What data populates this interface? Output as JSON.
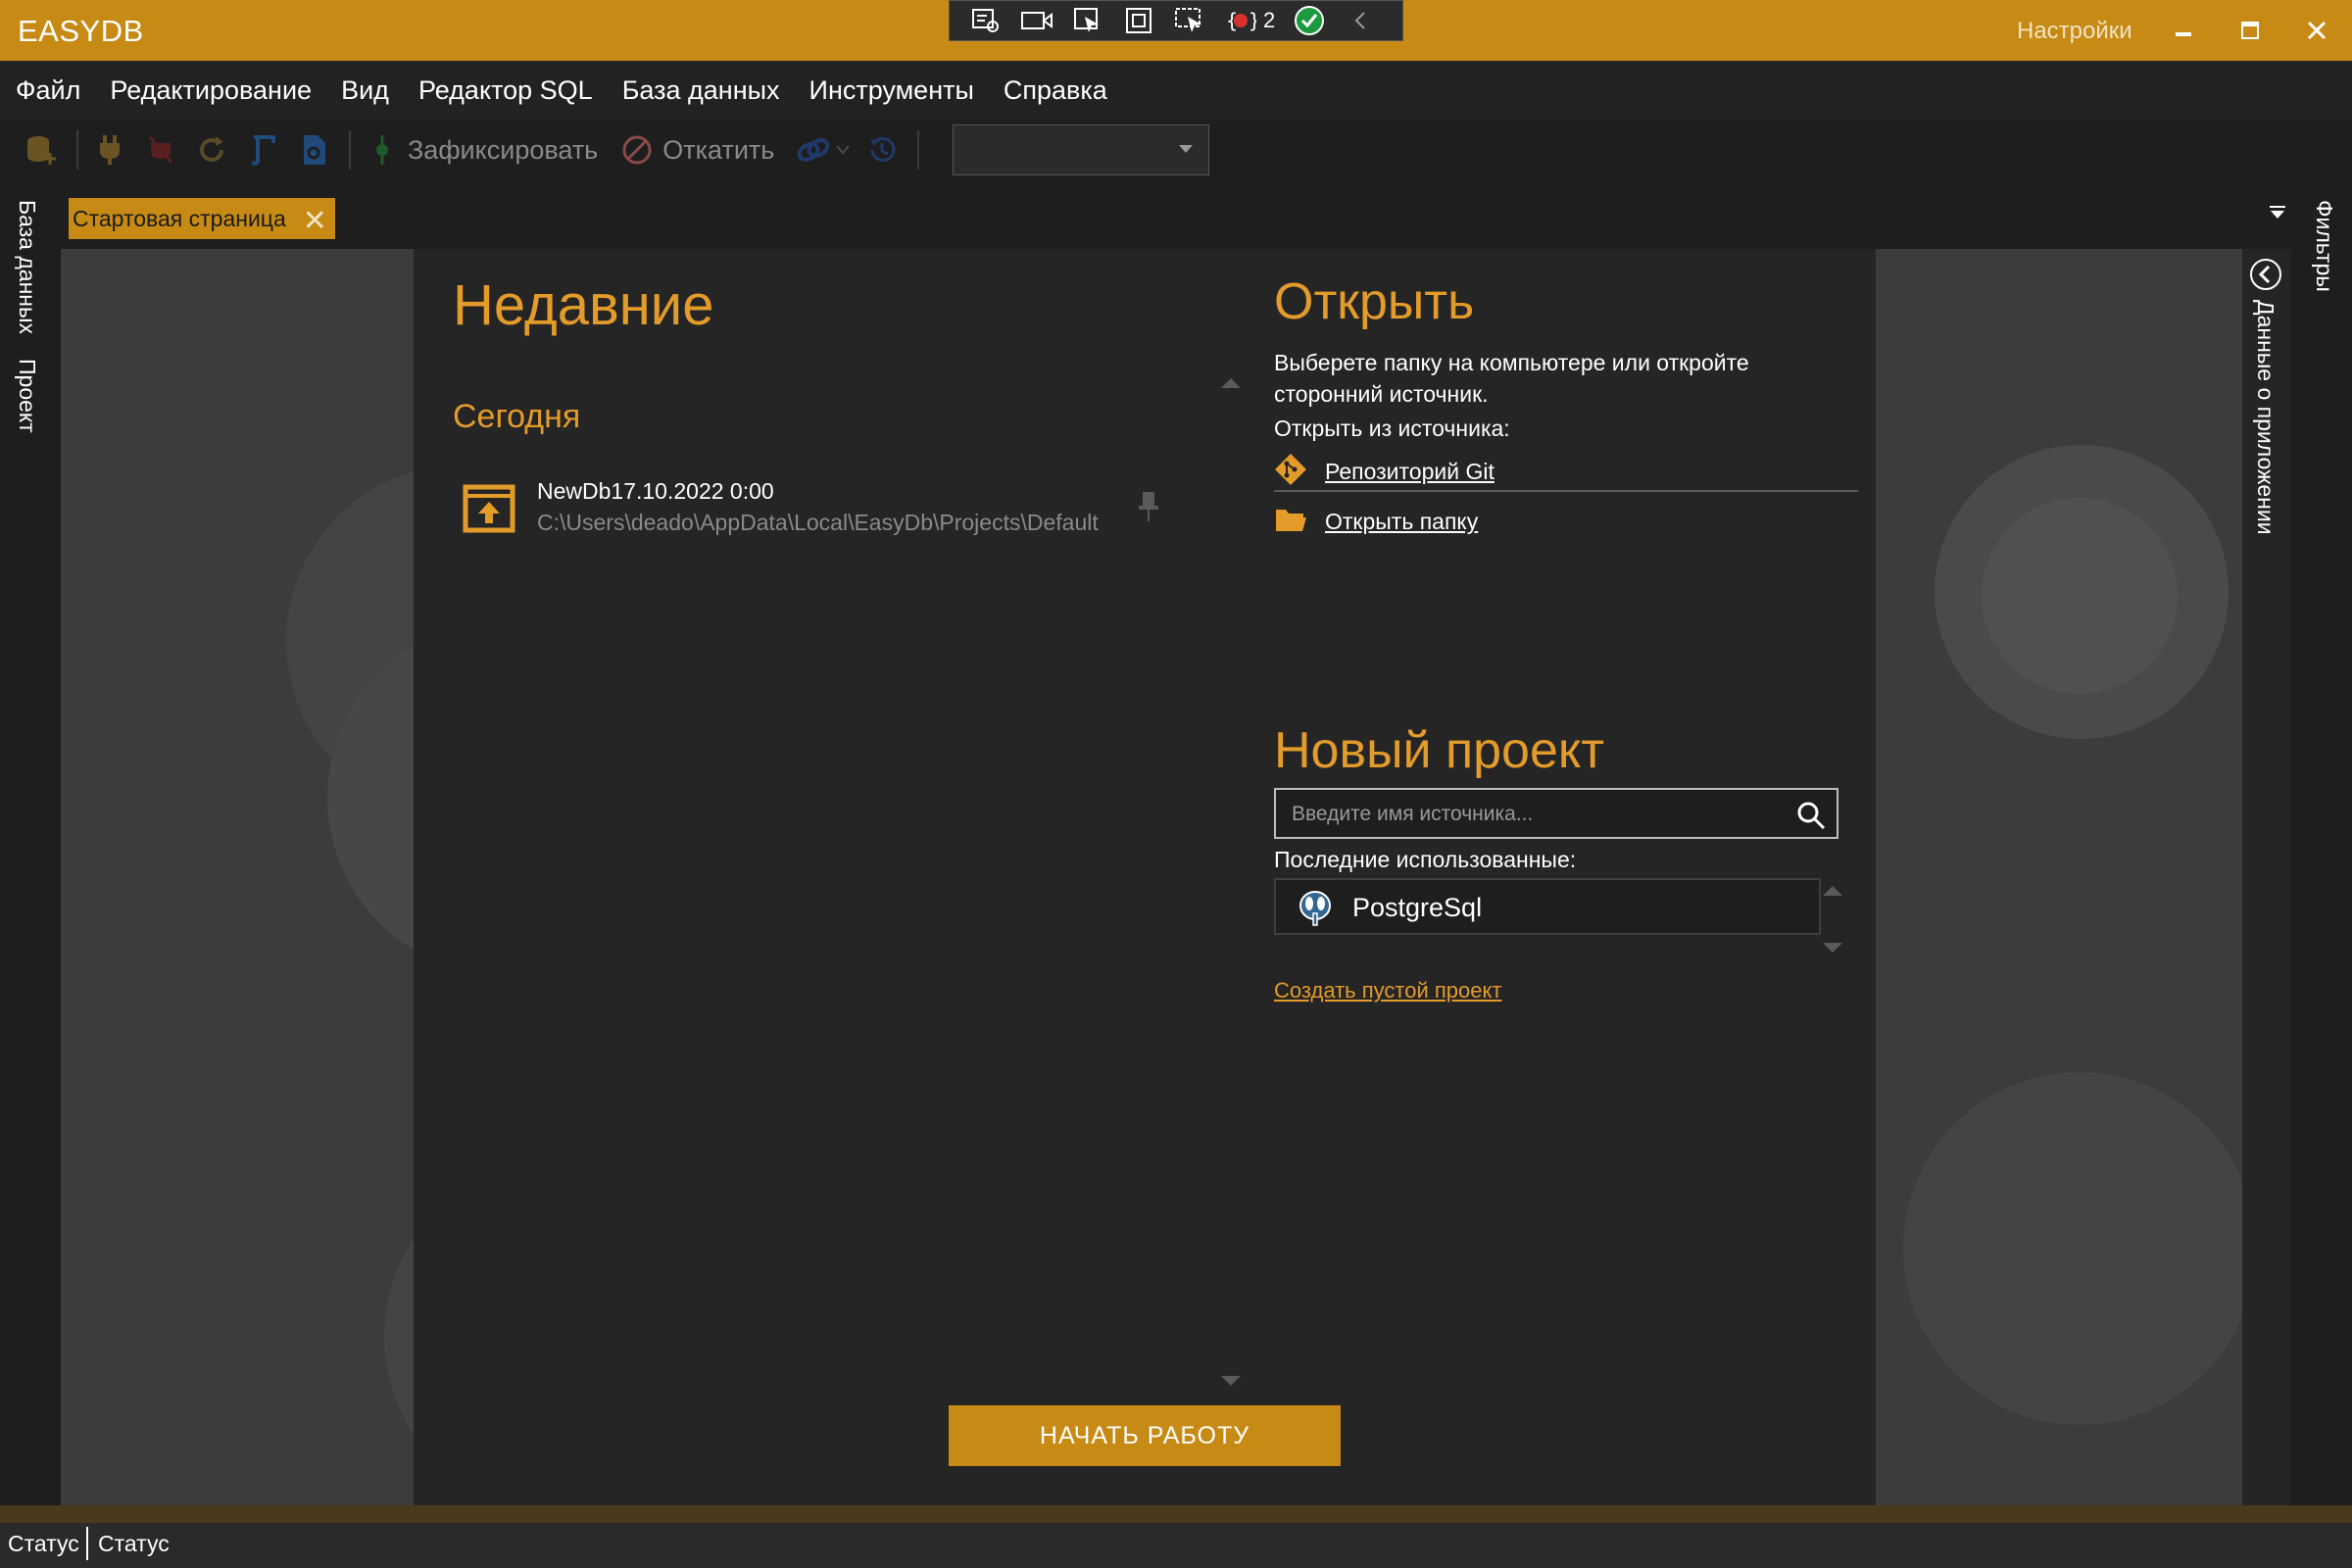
{
  "window": {
    "title": "EASYDB",
    "settings": "Настройки",
    "debug_badge_count": "2"
  },
  "menu": {
    "items": [
      "Файл",
      "Редактирование",
      "Вид",
      "Редактор SQL",
      "База данных",
      "Инструменты",
      "Справка"
    ]
  },
  "toolbar": {
    "commit_label": "Зафиксировать",
    "rollback_label": "Откатить",
    "combo_value": ""
  },
  "left_panel": {
    "tabs": [
      "База данных",
      "Проект"
    ]
  },
  "right_panel": {
    "filters": "Фильтры",
    "app_data": "Данные о приложении"
  },
  "tabs": {
    "start_page": "Стартовая страница"
  },
  "recent": {
    "title": "Недавние",
    "today": "Сегодня",
    "items": [
      {
        "name": "NewDb17.10.2022 0:00",
        "path": "C:\\Users\\deado\\AppData\\Local\\EasyDb\\Projects\\Default"
      }
    ]
  },
  "open": {
    "title": "Открыть",
    "description": "Выберете папку на компьютере или откройте сторонний источник.",
    "from_source": "Открыть из источника:",
    "git_link": "Репозиторий Git",
    "folder_link": "Открыть папку"
  },
  "new_project": {
    "title": "Новый проект",
    "search_placeholder": "Введите имя источника...",
    "recent_used_label": "Последние использованные:",
    "recent_sources": [
      "PostgreSql"
    ],
    "create_empty": "Создать пустой проект"
  },
  "start_button": "НАЧАТЬ РАБОТУ",
  "status": {
    "left": "Статус",
    "right": "Статус"
  },
  "colors": {
    "accent": "#c78a14",
    "accent_text": "#e39b2a",
    "background": "#1e1e1e",
    "panel": "#252525"
  }
}
